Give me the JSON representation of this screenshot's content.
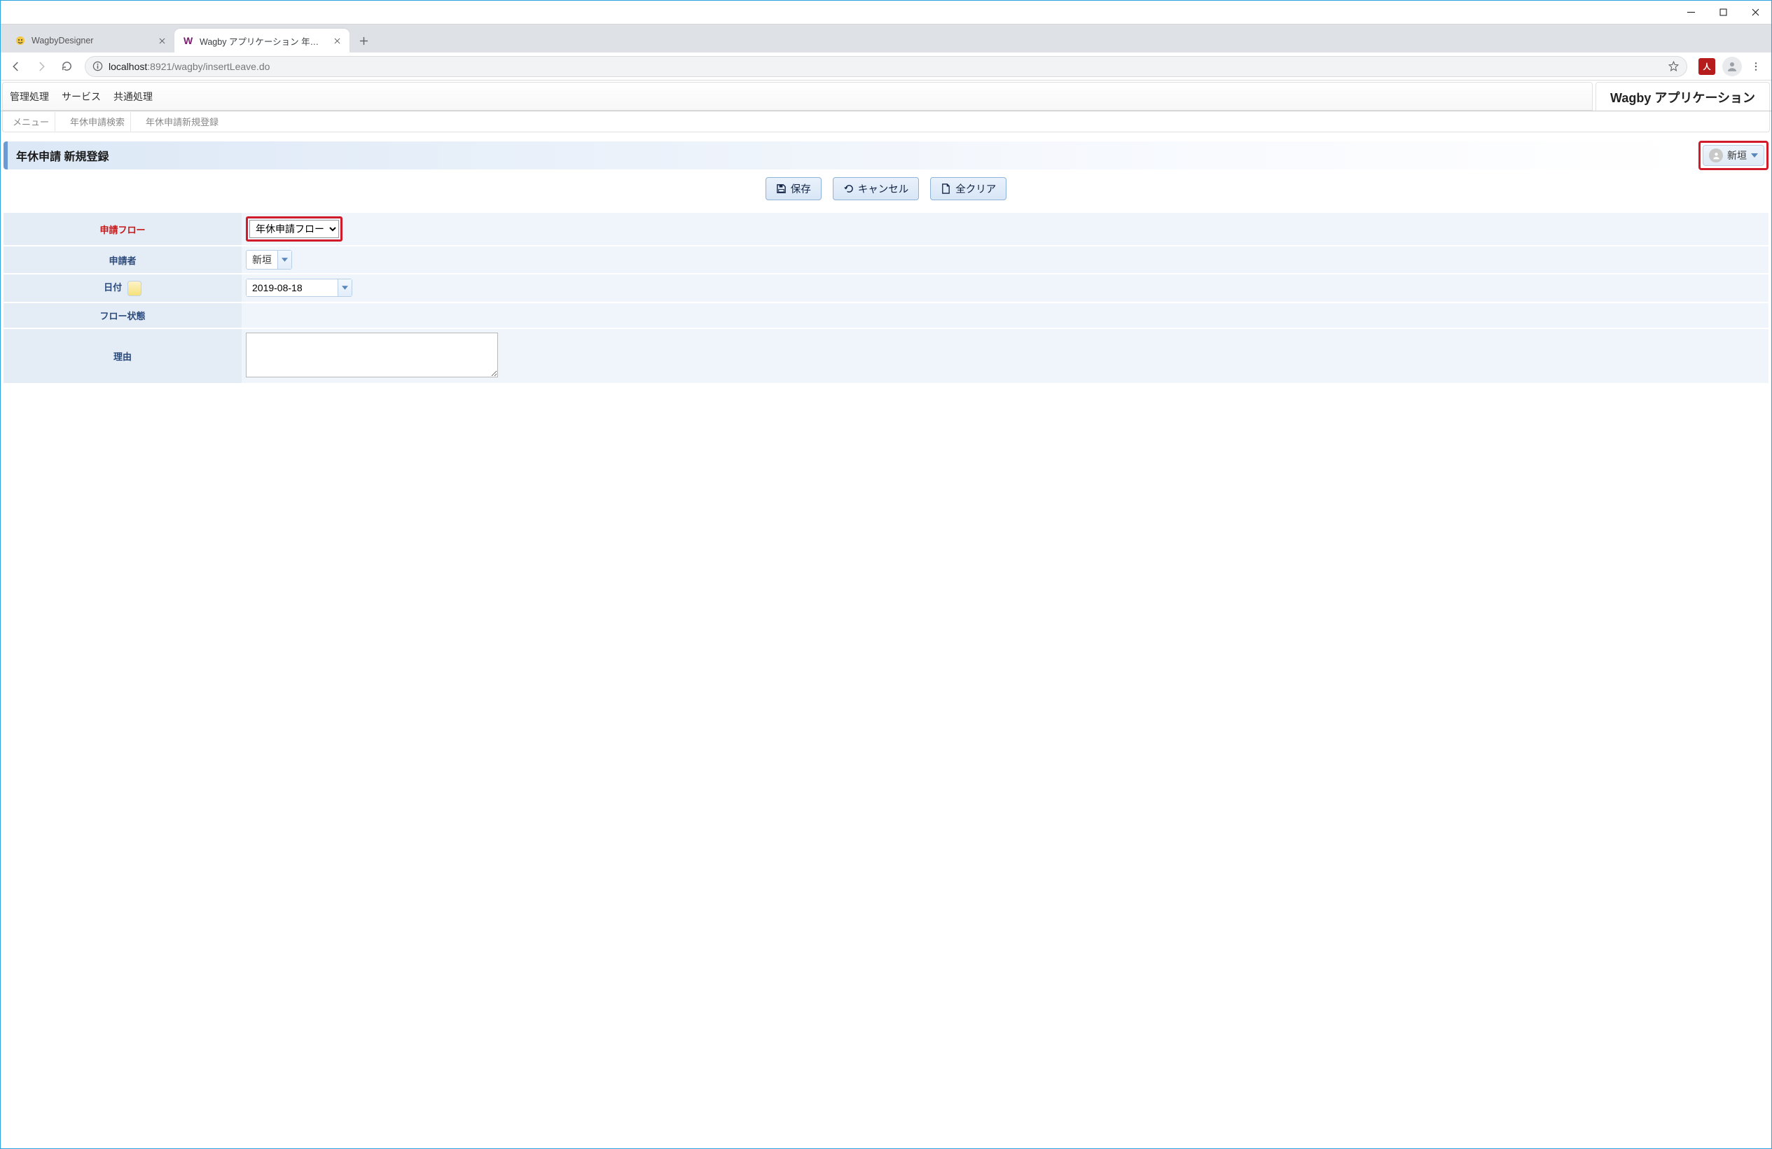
{
  "browser": {
    "tabs": [
      {
        "title": "WagbyDesigner",
        "active": false
      },
      {
        "title": "Wagby アプリケーション 年休申請新",
        "active": true
      }
    ],
    "url_host": "localhost",
    "url_rest": ":8921/wagby/insertLeave.do",
    "ext_badge": "人"
  },
  "appnav": {
    "menus": [
      "管理処理",
      "サービス",
      "共通処理"
    ],
    "app_name": "Wagby アプリケーション"
  },
  "breadcrumb": [
    "メニュー",
    "年休申請検索",
    "年休申請新規登録"
  ],
  "page_title": "年休申請 新規登録",
  "user_chip": {
    "name": "新垣"
  },
  "actions": {
    "save": "保存",
    "cancel": "キャンセル",
    "clear": "全クリア"
  },
  "form": {
    "labels": {
      "flow": "申請フロー",
      "applicant": "申請者",
      "date": "日付",
      "flow_state": "フロー状態",
      "reason": "理由"
    },
    "flow_select": {
      "selected": "年休申請フロー"
    },
    "applicant": {
      "value": "新垣"
    },
    "date": {
      "value": "2019-08-18"
    },
    "flow_state": "",
    "reason": ""
  }
}
